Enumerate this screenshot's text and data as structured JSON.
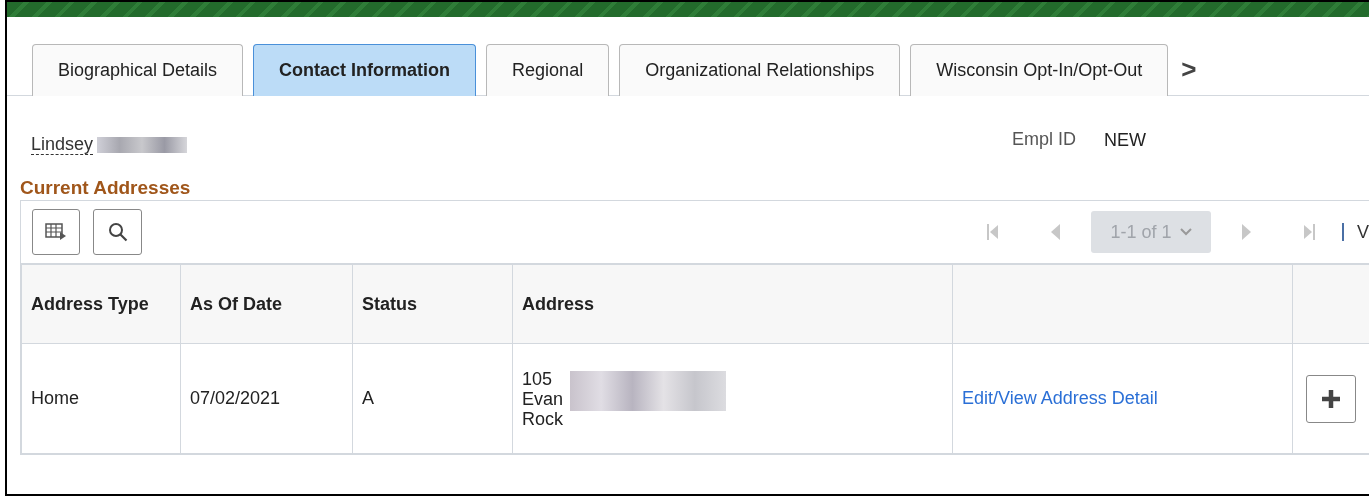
{
  "tabs": [
    {
      "label": "Biographical Details",
      "selected": false
    },
    {
      "label": "Contact Information",
      "selected": true
    },
    {
      "label": "Regional",
      "selected": false
    },
    {
      "label": "Organizational Relationships",
      "selected": false
    },
    {
      "label": "Wisconsin Opt-In/Opt-Out",
      "selected": false
    }
  ],
  "tab_scroll": ">",
  "person": {
    "name": "Lindsey",
    "empl_id_label": "Empl ID",
    "empl_id": "NEW"
  },
  "section_title": "Current Addresses",
  "pagination": {
    "range": "1-1 of 1",
    "view_all": "V"
  },
  "table": {
    "columns": [
      "Address Type",
      "As Of Date",
      "Status",
      "Address"
    ],
    "rows": [
      {
        "cells": [
          "Home",
          "07/02/2021",
          "A"
        ],
        "address_lines": [
          "105",
          "Evan",
          "Rock"
        ],
        "link": "Edit/View Address Detail"
      }
    ]
  }
}
